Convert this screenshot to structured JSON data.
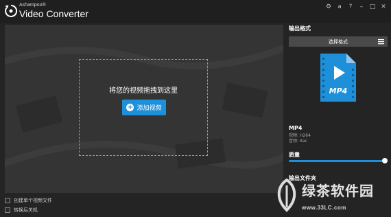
{
  "app": {
    "brand": "Ashampoo®",
    "title": "Video Converter"
  },
  "titlebar_icons": [
    "gear-icon",
    "text-a-icon",
    "help-icon",
    "minimize-icon",
    "maximize-icon",
    "close-icon"
  ],
  "titlebar_glyphs": {
    "gear": "⚙",
    "text": "a",
    "help": "?",
    "minimize": "–",
    "maximize": "□",
    "close": "✕"
  },
  "main": {
    "drop_text": "将您的视频拖拽到这里",
    "add_button_label": "添加视频"
  },
  "options": [
    {
      "label": "创建单个视频文件",
      "checked": false
    },
    {
      "label": "转换后关机",
      "checked": false
    }
  ],
  "side": {
    "output_format_heading": "输出格式",
    "select_format_label": "选择格式",
    "format_icon_label": "MP4",
    "format_name": "MP4",
    "video_codec": "视频: H264",
    "audio_codec": "音频: Aac",
    "quality_heading": "质量",
    "quality_value": 1.0,
    "output_folder_heading": "输出文件夹"
  },
  "watermark": {
    "text": "绿茶软件园",
    "site": "www.33LC.com"
  },
  "colors": {
    "accent": "#1e8fd9",
    "background": "#242424",
    "panel": "#333333"
  }
}
